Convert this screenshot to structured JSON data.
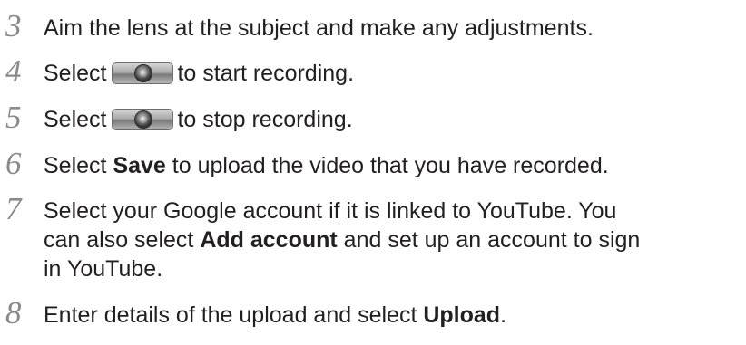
{
  "steps": [
    {
      "number": "3",
      "text": "Aim the lens at the subject and make any adjustments."
    },
    {
      "number": "4",
      "before": "Select",
      "icon": "record-button-icon",
      "after": "to start recording."
    },
    {
      "number": "5",
      "before": "Select",
      "icon": "record-button-icon",
      "after": "to stop recording."
    },
    {
      "number": "6",
      "before": "Select ",
      "bold": "Save",
      "after": " to upload the video that you have recorded."
    },
    {
      "number": "7",
      "line1": "Select your Google account if it is linked to YouTube. You",
      "line2_before": "can also select ",
      "line2_bold": "Add account",
      "line2_after": " and set up an account to sign",
      "line3": "in YouTube."
    },
    {
      "number": "8",
      "before": "Enter details of the upload and select ",
      "bold": "Upload",
      "after": "."
    }
  ]
}
